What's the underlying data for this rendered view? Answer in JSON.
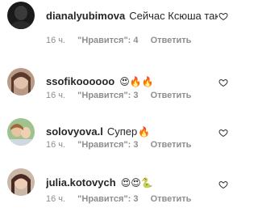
{
  "comments": [
    {
      "username": "dianalyubimova",
      "text": "Сейчас Ксюша такая - не понял",
      "emojis": "😺🤢",
      "time": "16 ч.",
      "likes": "\"Нравится\": 4",
      "reply": "Ответить"
    },
    {
      "username": "ssofikoooooo",
      "text": "",
      "emojis": "😍🔥🔥",
      "time": "16 ч.",
      "likes": "\"Нравится\": 3",
      "reply": "Ответить"
    },
    {
      "username": "solovyova.l",
      "text": "Супер",
      "emojis": "🔥",
      "time": "16 ч.",
      "likes": "\"Нравится\": 3",
      "reply": "Ответить"
    },
    {
      "username": "julia.kotovych",
      "text": "",
      "emojis": "😍😍🐍",
      "time": "16 ч.",
      "likes": "\"Нравится\": 3",
      "reply": "Ответить"
    }
  ]
}
